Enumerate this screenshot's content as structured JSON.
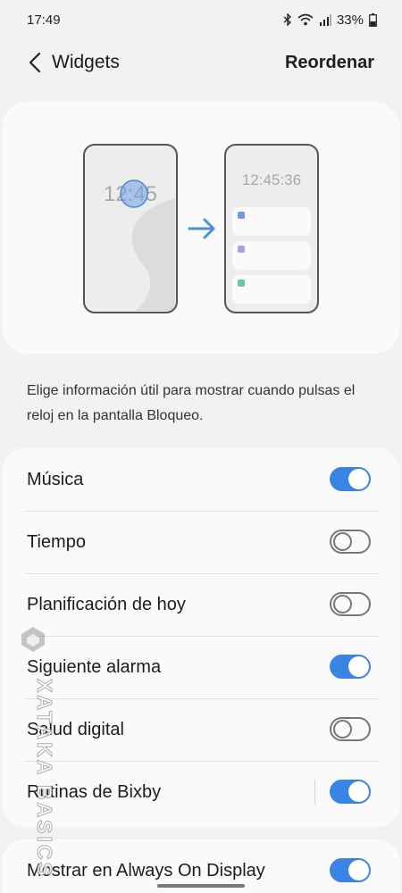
{
  "status_bar": {
    "time": "17:49",
    "battery": "33%",
    "icons": [
      "bluetooth-icon",
      "wifi-icon",
      "signal-icon",
      "battery-icon"
    ]
  },
  "header": {
    "title": "Widgets",
    "reorder_label": "Reordenar"
  },
  "preview": {
    "before_time": "12:45",
    "after_time": "12:45:36",
    "widget_dot_colors": [
      "#6a9ae6",
      "#b49be6",
      "#68c6a3"
    ],
    "accent": "#4a90d9"
  },
  "description": "Elige información útil para mostrar cuando pulsas el reloj en la pantalla Bloqueo.",
  "widgets": [
    {
      "label": "Música",
      "enabled": true
    },
    {
      "label": "Tiempo",
      "enabled": false
    },
    {
      "label": "Planificación de hoy",
      "enabled": false
    },
    {
      "label": "Siguiente alarma",
      "enabled": true
    },
    {
      "label": "Salud digital",
      "enabled": false
    },
    {
      "label": "Rutinas de Bixby",
      "enabled": true
    }
  ],
  "always_on": {
    "label": "Mostrar en Always On Display",
    "enabled": true
  },
  "watermark": "XATAKA BASICS",
  "colors": {
    "toggle_on": "#3a84e6",
    "background": "#f2f2f2",
    "card": "#fafafa"
  }
}
